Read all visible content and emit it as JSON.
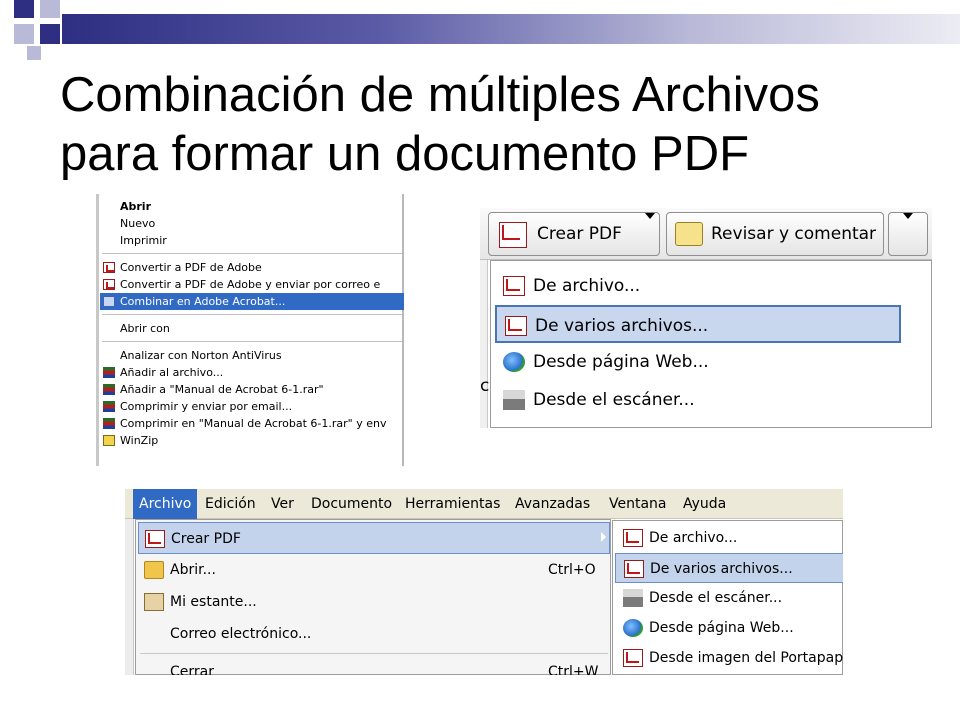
{
  "slide": {
    "title_line1": "Combinación de múltiples Archivos",
    "title_line2": "para formar un documento PDF"
  },
  "context_menu": {
    "items": [
      {
        "label": "Abrir",
        "bold": true,
        "icon": "none"
      },
      {
        "label": "Nuevo",
        "icon": "none"
      },
      {
        "label": "Imprimir",
        "icon": "none"
      },
      {
        "label": "Convertir a PDF de Adobe",
        "icon": "pdf-icon"
      },
      {
        "label": "Convertir a PDF de Adobe y enviar por correo e",
        "icon": "pdf-icon"
      },
      {
        "label": "Combinar en Adobe Acrobat...",
        "icon": "combine-icon",
        "selected": true
      },
      {
        "label": "Abrir con",
        "icon": "none"
      },
      {
        "label": "Analizar con Norton AntiVirus",
        "icon": "none"
      },
      {
        "label": "Añadir al archivo...",
        "icon": "winrar-icon"
      },
      {
        "label": "Añadir a \"Manual de Acrobat 6-1.rar\"",
        "icon": "winrar-icon"
      },
      {
        "label": "Comprimir y enviar por email...",
        "icon": "winrar-icon"
      },
      {
        "label": "Comprimir en \"Manual de Acrobat 6-1.rar\" y env",
        "icon": "winrar-icon"
      },
      {
        "label": "WinZip",
        "icon": "winzip-icon"
      }
    ]
  },
  "toolbar_panel": {
    "create_pdf_label": "Crear PDF",
    "review_label": "Revisar y comentar",
    "fragment_c": "c",
    "menu": [
      {
        "label": "De archivo...",
        "icon": "pdf-file-icon"
      },
      {
        "label": "De varios archivos...",
        "icon": "multi-pdf-icon",
        "selected": true
      },
      {
        "label": "Desde página Web...",
        "icon": "web-icon"
      },
      {
        "label": "Desde el escáner...",
        "icon": "scanner-icon"
      }
    ]
  },
  "menubar_panel": {
    "menubar": [
      "Archivo",
      "Edición",
      "Ver",
      "Documento",
      "Herramientas",
      "Avanzadas",
      "Ventana",
      "Ayuda"
    ],
    "dropdown": [
      {
        "label": "Crear PDF",
        "icon": "pdf-icon",
        "shortcut": "",
        "selected": true
      },
      {
        "label": "Abrir...",
        "icon": "folder-icon",
        "shortcut": "Ctrl+O"
      },
      {
        "label": "Mi estante...",
        "icon": "shelf-icon",
        "shortcut": ""
      },
      {
        "label": "Correo electrónico...",
        "icon": "none",
        "shortcut": ""
      },
      {
        "label": "Cerrar",
        "icon": "none",
        "shortcut": "Ctrl+W"
      }
    ],
    "submenu": [
      {
        "label": "De archivo...",
        "icon": "pdf-file-icon"
      },
      {
        "label": "De varios archivos...",
        "icon": "multi-pdf-icon",
        "selected": true
      },
      {
        "label": "Desde el escáner...",
        "icon": "scanner-icon"
      },
      {
        "label": "Desde página Web...",
        "icon": "web-icon"
      },
      {
        "label": "Desde imagen del Portapape",
        "icon": "clipboard-icon"
      }
    ]
  }
}
